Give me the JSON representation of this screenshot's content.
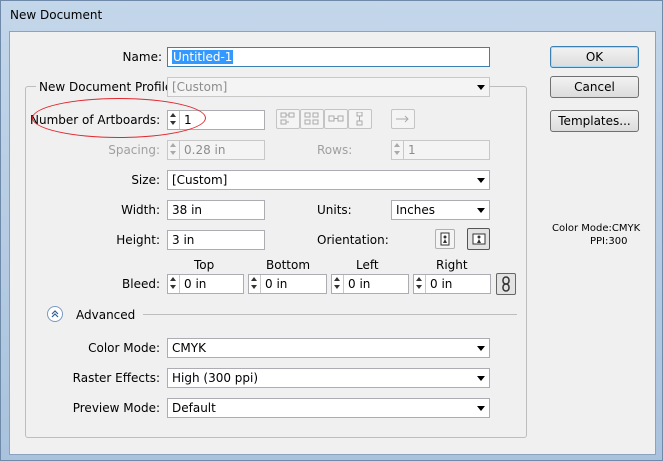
{
  "window": {
    "title": "New Document"
  },
  "buttons": {
    "ok": "OK",
    "cancel": "Cancel",
    "templates": "Templates..."
  },
  "name": {
    "label": "Name:",
    "value": "Untitled-1"
  },
  "profile": {
    "label": "New Document Profile:",
    "value": "[Custom]"
  },
  "artboards": {
    "label": "Number of Artboards:",
    "value": "1"
  },
  "spacing": {
    "label": "Spacing:",
    "value": "0.28 in"
  },
  "rows": {
    "label": "Rows:",
    "value": "1"
  },
  "size": {
    "label": "Size:",
    "value": "[Custom]"
  },
  "width": {
    "label": "Width:",
    "value": "38 in"
  },
  "units": {
    "label": "Units:",
    "value": "Inches"
  },
  "height": {
    "label": "Height:",
    "value": "3 in"
  },
  "orientation": {
    "label": "Orientation:",
    "selected": "landscape"
  },
  "bleed": {
    "label": "Bleed:",
    "columns": [
      "Top",
      "Bottom",
      "Left",
      "Right"
    ],
    "values": [
      "0 in",
      "0 in",
      "0 in",
      "0 in"
    ]
  },
  "advanced": {
    "label": "Advanced",
    "color_mode": {
      "label": "Color Mode:",
      "value": "CMYK"
    },
    "raster_effects": {
      "label": "Raster Effects:",
      "value": "High (300 ppi)"
    },
    "preview_mode": {
      "label": "Preview Mode:",
      "value": "Default"
    }
  },
  "summary": {
    "color_mode": "Color Mode:CMYK",
    "ppi": "PPI:300"
  },
  "colors": {
    "annotation": "#e0272f",
    "selection": "#3399ff"
  }
}
